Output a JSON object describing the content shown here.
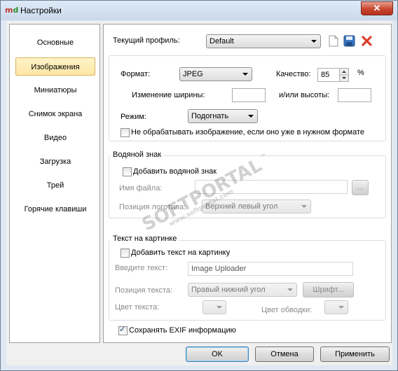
{
  "window": {
    "title": "Настройки",
    "close_label": "✕"
  },
  "sidebar": {
    "items": [
      {
        "label": "Основные"
      },
      {
        "label": "Изображения"
      },
      {
        "label": "Миниатюры"
      },
      {
        "label": "Снимок экрана"
      },
      {
        "label": "Видео"
      },
      {
        "label": "Загрузка"
      },
      {
        "label": "Трей"
      },
      {
        "label": "Горячие клавиши"
      }
    ],
    "active_index": 1
  },
  "profile": {
    "label": "Текущий профиль:",
    "value": "Default"
  },
  "image": {
    "format_label": "Формат:",
    "format_value": "JPEG",
    "quality_label": "Качество:",
    "quality_value": "85",
    "quality_unit": "%",
    "width_label": "Изменение ширины:",
    "width_value": "",
    "height_label": "и/или высоты:",
    "height_value": "",
    "mode_label": "Режим:",
    "mode_value": "Подогнать",
    "skip_label": "Не обрабатывать изображение, если оно уже в нужном формате",
    "skip_checked": false
  },
  "watermark": {
    "group_title": "Водяной знак",
    "add_label": "Добавить водяной знак",
    "add_checked": false,
    "file_label": "Имя файла:",
    "file_value": "",
    "browse_label": "...",
    "position_label": "Позиция логотипа:",
    "position_value": "Верхний левый угол"
  },
  "text_overlay": {
    "group_title": "Текст на картинке",
    "add_label": "Добавить текст на картинку",
    "add_checked": false,
    "text_label": "Введите текст:",
    "text_value": "Image Uploader",
    "position_label": "Позиция текста:",
    "position_value": "Правый нижний угол",
    "font_button": "Шрифт...",
    "text_color_label": "Цвет текста:",
    "stroke_color_label": "Цвет обводки:"
  },
  "exif": {
    "label": "Сохранять EXIF информацию",
    "checked": true
  },
  "footer": {
    "ok": "OK",
    "cancel": "Отмена",
    "apply": "Применить"
  },
  "watermark_overlay": {
    "line1": "SOFTPORTAL",
    "line2": "www.softportal.com",
    "mark": "™"
  }
}
